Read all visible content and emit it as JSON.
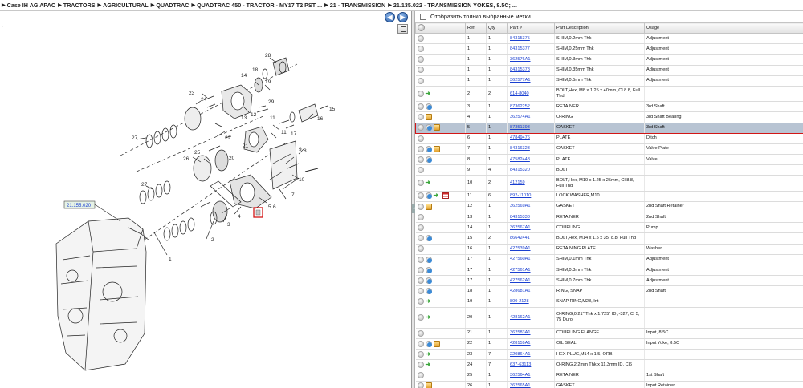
{
  "breadcrumb": [
    "Case IH AG APAC",
    "TRACTORS",
    "AGRICULTURAL",
    "QUADTRAC",
    "QUADTRAC 450 - TRACTOR - MY17 T2 PST ...",
    "21 - TRANSMISSION",
    "21.135.022 - TRANSMISSION YOKES, 8.5C; ..."
  ],
  "nav": {
    "back": "◀",
    "forward": "▶"
  },
  "drawing": {
    "callouts": [
      "1",
      "2",
      "3",
      "4",
      "5",
      "6",
      "7",
      "8",
      "9",
      "10",
      "11",
      "12",
      "13",
      "14",
      "15",
      "16",
      "17",
      "18",
      "19",
      "20",
      "21",
      "22",
      "23",
      "24",
      "25",
      "26",
      "27",
      "27",
      "28",
      "29"
    ],
    "ref_box": "21.155.020",
    "highlight_label": "5"
  },
  "filter": {
    "label": "Отобразить только выбранные метки"
  },
  "table": {
    "headers": [
      "Ref",
      "Qty",
      "Part #",
      "Part Description",
      "Usage"
    ],
    "rows": [
      {
        "h": 1,
        "icons": [],
        "ref": "1",
        "qty": "1",
        "part": "84315375",
        "desc": "SHIM,0.2mm Thk",
        "usage": "Adjustment"
      },
      {
        "h": 1,
        "icons": [],
        "ref": "1",
        "qty": "1",
        "part": "84315377",
        "desc": "SHIM,0.25mm Thk",
        "usage": "Adjustment"
      },
      {
        "h": 1,
        "icons": [],
        "ref": "1",
        "qty": "1",
        "part": "362576A1",
        "desc": "SHIM,0.3mm Thk",
        "usage": "Adjustment"
      },
      {
        "h": 1,
        "icons": [],
        "ref": "1",
        "qty": "1",
        "part": "84315378",
        "desc": "SHIM,0.35mm Thk",
        "usage": "Adjustment"
      },
      {
        "h": 1,
        "icons": [],
        "ref": "1",
        "qty": "1",
        "part": "362577A1",
        "desc": "SHIM,0.5mm Thk",
        "usage": "Adjustment"
      },
      {
        "h": 2,
        "icons": [
          "arrow"
        ],
        "ref": "2",
        "qty": "2",
        "part": "614-8040",
        "desc": "BOLT,Hex, M8 x 1.25 x 40mm, Cl 8.8, Full Thd",
        "usage": ""
      },
      {
        "h": 1,
        "icons": [
          "info"
        ],
        "ref": "3",
        "qty": "1",
        "part": "87362252",
        "desc": "RETAINER",
        "usage": "3rd Shaft"
      },
      {
        "h": 1,
        "icons": [
          "box"
        ],
        "ref": "4",
        "qty": "1",
        "part": "362574A1",
        "desc": "O-RING",
        "usage": "3rd Shaft Bearing"
      },
      {
        "h": 1,
        "icons": [
          "info",
          "box"
        ],
        "ref": "5",
        "qty": "1",
        "part": "87351393",
        "desc": "GASKET",
        "usage": "3rd Shaft",
        "selected": true
      },
      {
        "h": 1,
        "icons": [],
        "ref": "6",
        "qty": "1",
        "part": "47849476",
        "desc": "PLATE",
        "usage": "Ditch"
      },
      {
        "h": 1,
        "icons": [
          "info",
          "box"
        ],
        "ref": "7",
        "qty": "1",
        "part": "84316323",
        "desc": "GASKET",
        "usage": "Valve Plate"
      },
      {
        "h": 1,
        "icons": [
          "info"
        ],
        "ref": "8",
        "qty": "1",
        "part": "47582448",
        "desc": "PLATE",
        "usage": "Valve"
      },
      {
        "h": 1,
        "icons": [],
        "ref": "9",
        "qty": "4",
        "part": "84315320",
        "desc": "BOLT",
        "usage": ""
      },
      {
        "h": 2,
        "icons": [
          "arrow"
        ],
        "ref": "10",
        "qty": "2",
        "part": "412159",
        "desc": "BOLT,Hex, M10 x 1.25 x 25mm, Cl 8.8, Full Thd",
        "usage": ""
      },
      {
        "h": 1,
        "icons": [
          "info",
          "arrow",
          "list"
        ],
        "ref": "11",
        "qty": "6",
        "part": "892-11010",
        "desc": "LOCK WASHER,M10",
        "usage": ""
      },
      {
        "h": 1,
        "icons": [
          "box"
        ],
        "ref": "12",
        "qty": "1",
        "part": "362569A1",
        "desc": "GASKET",
        "usage": "2nd Shaft Retainer"
      },
      {
        "h": 1,
        "icons": [],
        "ref": "13",
        "qty": "1",
        "part": "84315338",
        "desc": "RETAINER",
        "usage": "2nd Shaft"
      },
      {
        "h": 1,
        "icons": [],
        "ref": "14",
        "qty": "1",
        "part": "362567A1",
        "desc": "COUPLING",
        "usage": "Pump"
      },
      {
        "h": 1,
        "icons": [
          "info"
        ],
        "ref": "15",
        "qty": "2",
        "part": "86642441",
        "desc": "BOLT,Hex, M14 x 1.5 x 35, 8.8, Full Thd",
        "usage": ""
      },
      {
        "h": 1,
        "icons": [],
        "ref": "16",
        "qty": "1",
        "part": "427539A1",
        "desc": "RETAINING PLATE",
        "usage": "Washer"
      },
      {
        "h": 1,
        "icons": [
          "info"
        ],
        "ref": "17",
        "qty": "1",
        "part": "427560A1",
        "desc": "SHIM,0.1mm Thk",
        "usage": "Adjustment"
      },
      {
        "h": 1,
        "icons": [
          "info"
        ],
        "ref": "17",
        "qty": "1",
        "part": "427561A1",
        "desc": "SHIM,0.3mm Thk",
        "usage": "Adjustment"
      },
      {
        "h": 1,
        "icons": [
          "info"
        ],
        "ref": "17",
        "qty": "1",
        "part": "427562A1",
        "desc": "SHIM,0.7mm Thk",
        "usage": "Adjustment"
      },
      {
        "h": 1,
        "icons": [
          "info"
        ],
        "ref": "18",
        "qty": "1",
        "part": "428681A1",
        "desc": "RING, SNAP",
        "usage": "2nd Shaft"
      },
      {
        "h": 1,
        "icons": [
          "arrow"
        ],
        "ref": "19",
        "qty": "1",
        "part": "800-2128",
        "desc": "SNAP RING,M28, Int",
        "usage": ""
      },
      {
        "h": 3,
        "icons": [
          "arrow"
        ],
        "ref": "20",
        "qty": "1",
        "part": "428162A1",
        "desc": "O-RING,0.21\" Thk x 1.725\" ID, -327, Cl 5, 75 Duro",
        "usage": ""
      },
      {
        "h": 1,
        "icons": [],
        "ref": "21",
        "qty": "1",
        "part": "362583A1",
        "desc": "COUPLING FLANGE",
        "usage": "Input, 8.5C"
      },
      {
        "h": 1,
        "icons": [
          "info",
          "box"
        ],
        "ref": "22",
        "qty": "1",
        "part": "428159A1",
        "desc": "OIL SEAL",
        "usage": "Input Yoke, 8.5C"
      },
      {
        "h": 1,
        "icons": [
          "arrow"
        ],
        "ref": "23",
        "qty": "7",
        "part": "220864A1",
        "desc": "HEX PLUG,M14 x 1.5, ORB",
        "usage": ""
      },
      {
        "h": 1,
        "icons": [
          "arrow"
        ],
        "ref": "24",
        "qty": "7",
        "part": "637-63113",
        "desc": "O-RING,2.2mm Thk x 11.3mm ID, Cl6",
        "usage": ""
      },
      {
        "h": 1,
        "icons": [],
        "ref": "25",
        "qty": "1",
        "part": "362564A1",
        "desc": "RETAINER",
        "usage": "1st Shaft"
      },
      {
        "h": 1,
        "icons": [
          "box"
        ],
        "ref": "26",
        "qty": "1",
        "part": "362565A1",
        "desc": "GASKET",
        "usage": "Input Retainer"
      }
    ]
  },
  "colors": {
    "selected_row": "#b8c4d3",
    "highlight": "#d21616",
    "link": "#1a3fd0"
  }
}
